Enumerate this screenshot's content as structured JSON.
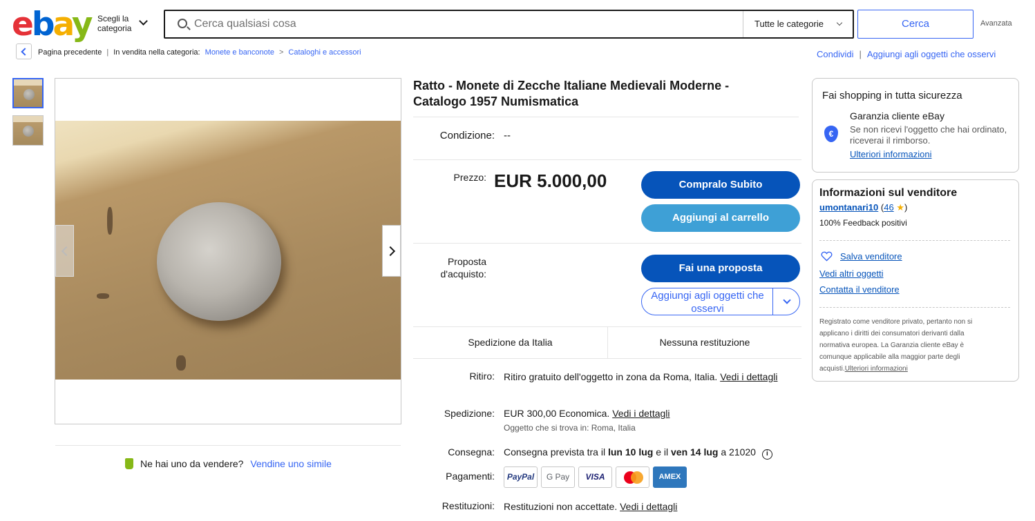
{
  "header": {
    "logo_letters": [
      "e",
      "b",
      "a",
      "y"
    ],
    "shop_by": "Scegli la categoria",
    "search_placeholder": "Cerca qualsiasi cosa",
    "category_select": "Tutte le categorie",
    "search_button": "Cerca",
    "advanced": "Avanzata"
  },
  "breadcrumb": {
    "back_label": "Pagina precedente",
    "listed_in": "In vendita nella categoria:",
    "crumb_1": "Monete e banconote",
    "crumb_2": "Cataloghi e accessori"
  },
  "top_actions": {
    "share": "Condividi",
    "watch": "Aggiungi agli oggetti che osservi"
  },
  "item": {
    "title": "Ratto - Monete di Zecche Italiane Medievali Moderne - Catalogo 1957 Numismatica",
    "condition_label": "Condizione:",
    "condition_value": "--",
    "price_label": "Prezzo:",
    "price": "EUR 5.000,00",
    "buy_now": "Compralo Subito",
    "add_to_cart": "Aggiungi al carrello",
    "offer_label": "Proposta d'acquisto:",
    "make_offer": "Fai una proposta",
    "watch_button": "Aggiungi agli oggetti che osservi",
    "ships_from": "Spedizione da Italia",
    "returns_short": "Nessuna restituzione",
    "pickup_label": "Ritiro:",
    "pickup_value": "Ritiro gratuito dell'oggetto in zona da Roma, Italia.",
    "see_details": "Vedi i dettagli",
    "shipping_label": "Spedizione:",
    "shipping_price": "EUR 300,00",
    "shipping_type": "Economica.",
    "item_location": "Oggetto che si trova in: Roma, Italia",
    "delivery_label": "Consegna:",
    "delivery_prefix": "Consegna prevista tra il",
    "delivery_from": "lun 10 lug",
    "delivery_mid": "e il",
    "delivery_to": "ven 14 lug",
    "delivery_suffix": "a 21020",
    "payments_label": "Pagamenti:",
    "payment_methods": [
      "PayPal",
      "G Pay",
      "VISA",
      "Mastercard",
      "AMEX"
    ],
    "returns_label": "Restituzioni:",
    "returns_value": "Restituzioni non accettate."
  },
  "sell_one": {
    "question": "Ne hai uno da vendere?",
    "link": "Vendine uno simile"
  },
  "safety": {
    "heading": "Fai shopping in tutta sicurezza",
    "guarantee_title": "Garanzia cliente eBay",
    "guarantee_text": "Se non ricevi l'oggetto che hai ordinato, riceverai il rimborso.",
    "more_info": "Ulteriori informazioni",
    "shield_symbol": "€"
  },
  "seller": {
    "heading": "Informazioni sul venditore",
    "name": "umontanari10",
    "score": "46",
    "feedback": "100% Feedback positivi",
    "save_seller": "Salva venditore",
    "see_items": "Vedi altri oggetti",
    "contact": "Contatta il venditore",
    "legal": "Registrato come venditore privato, pertanto non si applicano i diritti dei consumatori derivanti dalla normativa europea. La Garanzia cliente eBay è comunque applicabile alla maggior parte degli acquisti.",
    "legal_link": "Ulteriori informazioni"
  },
  "colors": {
    "ebay_red": "#e53238",
    "ebay_blue": "#0064d2",
    "ebay_yellow": "#f5af02",
    "ebay_green": "#86b817",
    "link_blue": "#3665f3",
    "primary_button": "#0654ba",
    "secondary_button": "#3ea0d6"
  },
  "icons": [
    "search-icon",
    "chevron-down-icon",
    "back-arrow-icon",
    "next-arrow-icon",
    "prev-arrow-icon",
    "price-tag-icon",
    "shield-euro-icon",
    "heart-icon",
    "star-icon",
    "info-icon"
  ]
}
